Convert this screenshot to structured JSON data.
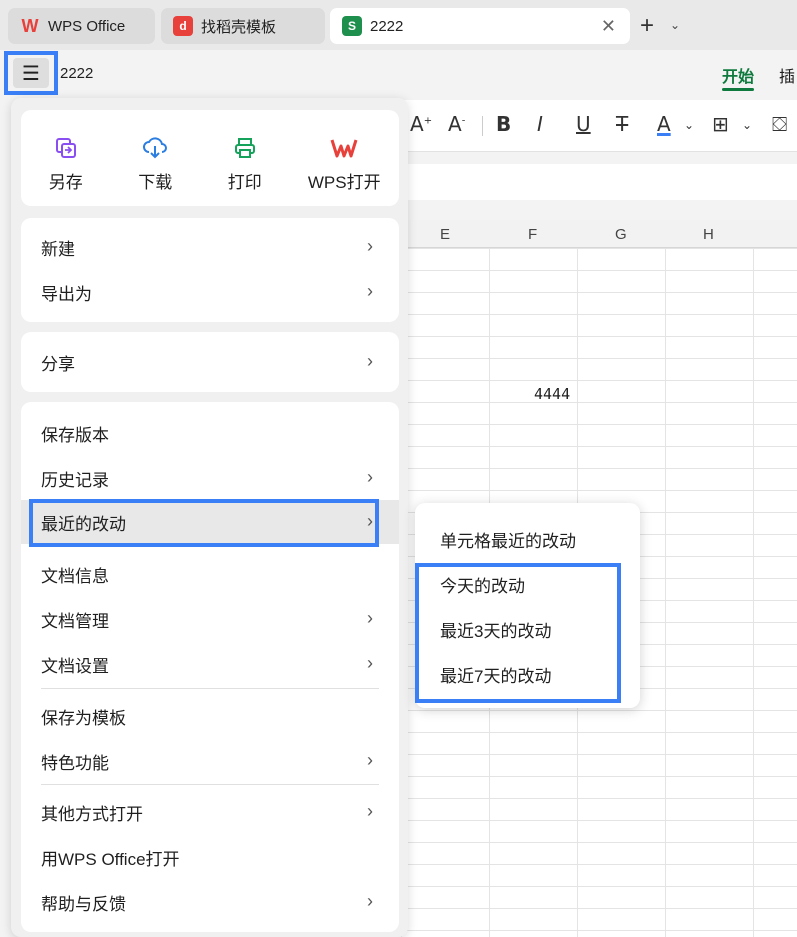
{
  "tabs": [
    {
      "label": "WPS Office",
      "active": false
    },
    {
      "label": "找稻壳模板",
      "active": false
    },
    {
      "label": "2222",
      "active": true
    }
  ],
  "titlebar": {
    "menu_icon": "hamburger-icon",
    "doc_title": "2222",
    "ribbon_tabs": [
      "开始",
      "插"
    ]
  },
  "sheet": {
    "columns": [
      "E",
      "F",
      "G",
      "H"
    ],
    "cell_value": "4444"
  },
  "menu": {
    "quick_actions": [
      {
        "label": "另存",
        "icon": "save-as-icon"
      },
      {
        "label": "下载",
        "icon": "download-icon"
      },
      {
        "label": "打印",
        "icon": "print-icon"
      },
      {
        "label": "WPS打开",
        "icon": "wps-logo-icon"
      }
    ],
    "group1": [
      "新建",
      "导出为"
    ],
    "group2": [
      "分享"
    ],
    "group3": [
      "保存版本",
      "历史记录",
      "最近的改动",
      "文档信息",
      "文档管理",
      "文档设置",
      "保存为模板",
      "特色功能",
      "其他方式打开",
      "用WPS Office打开",
      "帮助与反馈"
    ]
  },
  "submenu": {
    "items": [
      "单元格最近的改动",
      "今天的改动",
      "最近3天的改动",
      "最近7天的改动"
    ]
  },
  "colors": {
    "accent_green": "#0e7a3d",
    "highlight_blue": "#3a7ff6",
    "wps_red": "#e8403a"
  }
}
